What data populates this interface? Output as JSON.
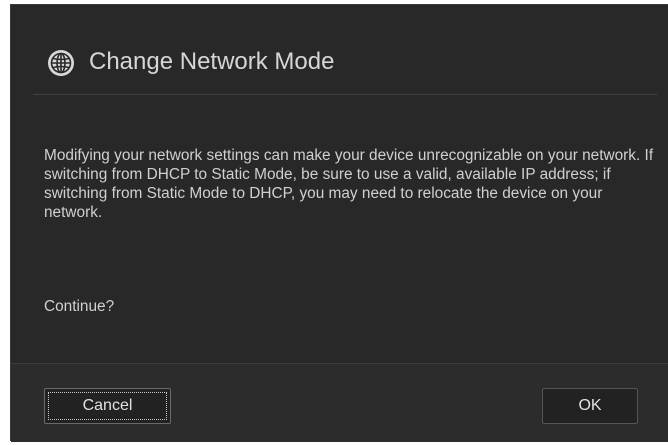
{
  "dialog": {
    "title": "Change Network Mode",
    "icon": "globe-icon",
    "message": "Modifying your network settings can make your device unrecognizable on your network. If switching from DHCP to Static Mode, be sure to use a valid, available IP address; if switching from Static Mode to DHCP, you may need to relocate the device on your network.",
    "confirm_prompt": "Continue?",
    "buttons": {
      "cancel_label": "Cancel",
      "ok_label": "OK"
    }
  },
  "colors": {
    "dialog_background": "#282828",
    "text": "#d0d0d0",
    "button_background": "#222222"
  }
}
